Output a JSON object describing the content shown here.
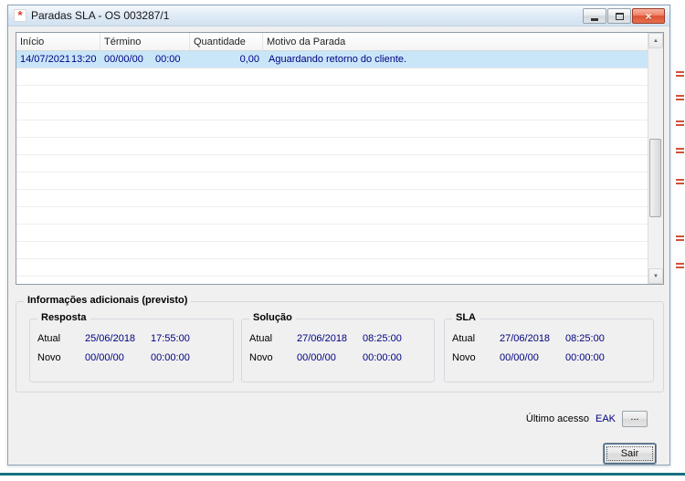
{
  "window": {
    "title": "Paradas SLA - OS 003287/1"
  },
  "icons": {
    "app_logo": "*",
    "close": "×",
    "scroll_up": "▲",
    "scroll_down": "▼"
  },
  "grid": {
    "columns": {
      "inicio": "Início",
      "termino": "Término",
      "quantidade": "Quantidade",
      "motivo": "Motivo da Parada"
    },
    "selected_row": {
      "inicio_date": "14/07/2021",
      "inicio_time": "13:20",
      "termino_date": "00/00/00",
      "termino_time": "00:00",
      "quantidade": "0,00",
      "motivo": "Aguardando retorno do cliente."
    }
  },
  "info_panel": {
    "title": "Informações adicionais (previsto)",
    "sections": [
      {
        "title": "Resposta",
        "rows": [
          {
            "label": "Atual",
            "date": "25/06/2018",
            "time": "17:55:00"
          },
          {
            "label": "Novo",
            "date": "00/00/00",
            "time": "00:00:00"
          }
        ]
      },
      {
        "title": "Solução",
        "rows": [
          {
            "label": "Atual",
            "date": "27/06/2018",
            "time": "08:25:00"
          },
          {
            "label": "Novo",
            "date": "00/00/00",
            "time": "00:00:00"
          }
        ]
      },
      {
        "title": "SLA",
        "rows": [
          {
            "label": "Atual",
            "date": "27/06/2018",
            "time": "08:25:00"
          },
          {
            "label": "Novo",
            "date": "00/00/00",
            "time": "00:00:00"
          }
        ]
      }
    ]
  },
  "footer": {
    "last_access_label": "Último acesso",
    "last_access_value": "EAK",
    "browse_button": "...",
    "exit_button": "Sair"
  },
  "colors": {
    "selection_bg": "#c9e6f9",
    "data_text": "#000080",
    "teal_line": "#15707f",
    "close_button": "#dc5334"
  }
}
